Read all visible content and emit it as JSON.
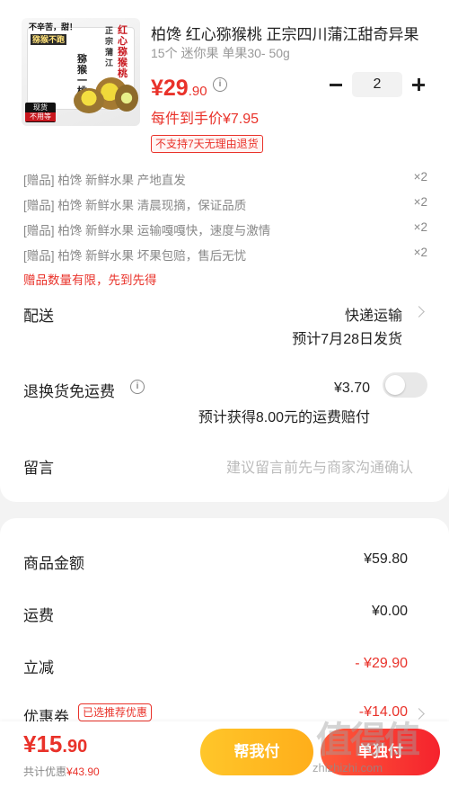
{
  "product": {
    "title": "柏馋 红心猕猴桃 正宗四川蒲江甜奇异果",
    "spec": "15个 迷你果 单果30- 50g",
    "price_main": "¥29",
    "price_decimal": ".90",
    "unit_price": "每件到手价¥7.95",
    "return_policy_tag": "不支持7天无理由退货",
    "quantity": "2",
    "image_text": {
      "line1": "不辛苦，甜！",
      "line2": "猕猴不跑",
      "side": "红心猕猴桃",
      "side2": "正宗蒲江",
      "tag_top": "现货",
      "tag_bottom": "不用等",
      "box_brand": "猕猴一桃"
    }
  },
  "gifts": [
    {
      "prefix": "[赠品]",
      "text": "柏馋 新鲜水果 产地直发",
      "qty": "×2"
    },
    {
      "prefix": "[赠品]",
      "text": "柏馋 新鲜水果 清晨现摘，保证品质",
      "qty": "×2"
    },
    {
      "prefix": "[赠品]",
      "text": "柏馋 新鲜水果 运输嘎嘎快，速度与激情",
      "qty": "×2"
    },
    {
      "prefix": "[赠品]",
      "text": "柏馋 新鲜水果 坏果包赔，售后无忧",
      "qty": "×2"
    }
  ],
  "gift_note": "赠品数量有限，先到先得",
  "delivery": {
    "label": "配送",
    "method": "快递运输",
    "ship_date": "预计7月28日发货"
  },
  "return_shipping": {
    "label": "退换货免运费",
    "price": "¥3.70",
    "compensation": "预计获得8.00元的运费赔付",
    "enabled": false
  },
  "message": {
    "label": "留言",
    "placeholder": "建议留言前先与商家沟通确认"
  },
  "summary": {
    "goods_label": "商品金额",
    "goods_value": "¥59.80",
    "shipping_label": "运费",
    "shipping_value": "¥0.00",
    "discount_label": "立减",
    "discount_value": "- ¥29.90",
    "coupon_label": "优惠券",
    "coupon_badge": "已选推荐优惠",
    "coupon_value": "-¥14.00"
  },
  "bottom": {
    "total_main": "¥15",
    "total_decimal": ".90",
    "discount_prefix": "共计优惠",
    "discount_total": "¥43.90",
    "help_pay": "帮我付",
    "pay": "单独付"
  },
  "watermark": {
    "logo": "值得值",
    "site": "zhizhizhi.com"
  },
  "colors": {
    "accent_red": "#e9322a",
    "help_button": "#ffb71f",
    "pay_button": "#f5222d"
  }
}
